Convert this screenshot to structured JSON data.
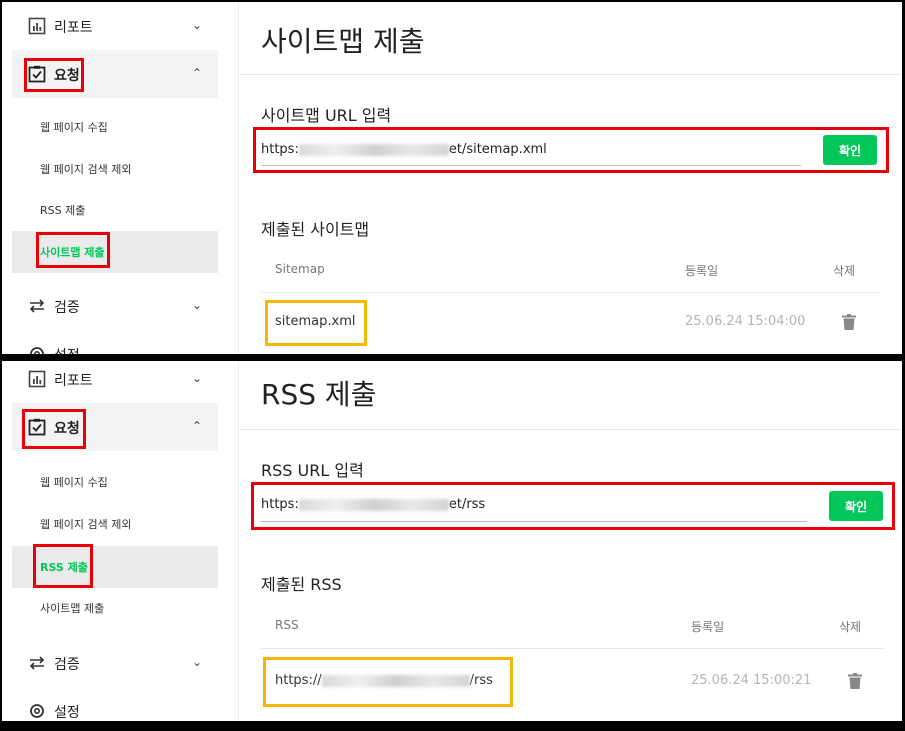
{
  "panels": [
    {
      "sidebar": {
        "report_label": "리포트",
        "request_label": "요청",
        "verify_label": "검증",
        "settings_label": "설정",
        "sub_items": [
          "웹 페이지 수집",
          "웹 페이지 검색 제외",
          "RSS 제출",
          "사이트맵 제출"
        ]
      },
      "main": {
        "title": "사이트맵 제출",
        "input_section_label": "사이트맵 URL 입력",
        "url_prefix": "https:",
        "url_suffix": "et/sitemap.xml",
        "confirm_label": "확인",
        "list_section_label": "제출된 사이트맵",
        "columns": [
          "Sitemap",
          "등록일",
          "삭제"
        ],
        "rows": [
          {
            "name": "sitemap.xml",
            "date": "25.06.24 15:04:00"
          }
        ]
      }
    },
    {
      "sidebar": {
        "report_label": "리포트",
        "request_label": "요청",
        "verify_label": "검증",
        "settings_label": "설정",
        "sub_items": [
          "웹 페이지 수집",
          "웹 페이지 검색 제외",
          "RSS 제출",
          "사이트맵 제출"
        ]
      },
      "main": {
        "title": "RSS 제출",
        "input_section_label": "RSS URL 입력",
        "url_prefix": "https:",
        "url_suffix": "et/rss",
        "confirm_label": "확인",
        "list_section_label": "제출된 RSS",
        "columns": [
          "RSS",
          "등록일",
          "삭제"
        ],
        "rows": [
          {
            "name_prefix": "https://",
            "name_suffix": "/rss",
            "date": "25.06.24 15:00:21"
          }
        ]
      }
    }
  ],
  "colors": {
    "accent": "#03c75a",
    "highlight_red": "#e8000a",
    "highlight_yellow": "#f7b600"
  },
  "icons": [
    "report-chart-icon",
    "request-check-icon",
    "verify-swap-icon",
    "settings-gear-icon",
    "chevron-down-icon",
    "chevron-up-icon",
    "trash-icon"
  ]
}
